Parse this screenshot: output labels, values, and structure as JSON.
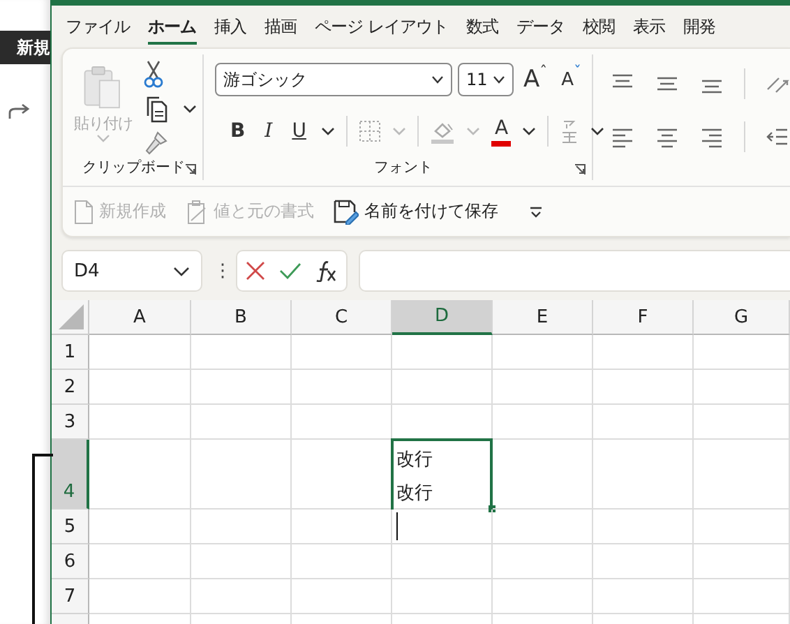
{
  "background_window": {
    "button": "新規"
  },
  "tabs": [
    {
      "label": "ファイル",
      "selected": false
    },
    {
      "label": "ホーム",
      "selected": true
    },
    {
      "label": "挿入",
      "selected": false
    },
    {
      "label": "描画",
      "selected": false
    },
    {
      "label": "ページ レイアウト",
      "selected": false
    },
    {
      "label": "数式",
      "selected": false
    },
    {
      "label": "データ",
      "selected": false
    },
    {
      "label": "校閲",
      "selected": false
    },
    {
      "label": "表示",
      "selected": false
    },
    {
      "label": "開発",
      "selected": false
    }
  ],
  "clipboard": {
    "paste_label": "貼り付け",
    "paste_disabled": true,
    "group_label": "クリップボード"
  },
  "font": {
    "name": "游ゴシック",
    "size": "11",
    "group_label": "フォント",
    "grow": "A",
    "grow_mark": "ˆ",
    "shrink": "A",
    "shrink_mark": "ˇ",
    "bold": "B",
    "italic": "I",
    "underline": "U",
    "color_letter": "A"
  },
  "quick_access": [
    {
      "label": "新規作成",
      "kind": "new",
      "disabled": true
    },
    {
      "label": "値と元の書式",
      "kind": "paste",
      "disabled": true
    },
    {
      "label": "名前を付けて保存",
      "kind": "save",
      "disabled": false
    }
  ],
  "name_box": "D4",
  "formula_separator": "⋮",
  "columns": [
    {
      "label": "A",
      "selected": false
    },
    {
      "label": "B",
      "selected": false
    },
    {
      "label": "C",
      "selected": false
    },
    {
      "label": "D",
      "selected": true
    },
    {
      "label": "E",
      "selected": false
    },
    {
      "label": "F",
      "selected": false
    },
    {
      "label": "G",
      "selected": false
    }
  ],
  "rows": [
    {
      "label": "1",
      "selected": false
    },
    {
      "label": "2",
      "selected": false
    },
    {
      "label": "3",
      "selected": false
    },
    {
      "label": "4",
      "selected": true,
      "cells": [
        {},
        {},
        {},
        {
          "lines": [
            "改行",
            "改行"
          ],
          "editing": true
        }
      ]
    },
    {
      "label": "5",
      "selected": false
    },
    {
      "label": "6",
      "selected": false
    },
    {
      "label": "7",
      "selected": false
    }
  ]
}
